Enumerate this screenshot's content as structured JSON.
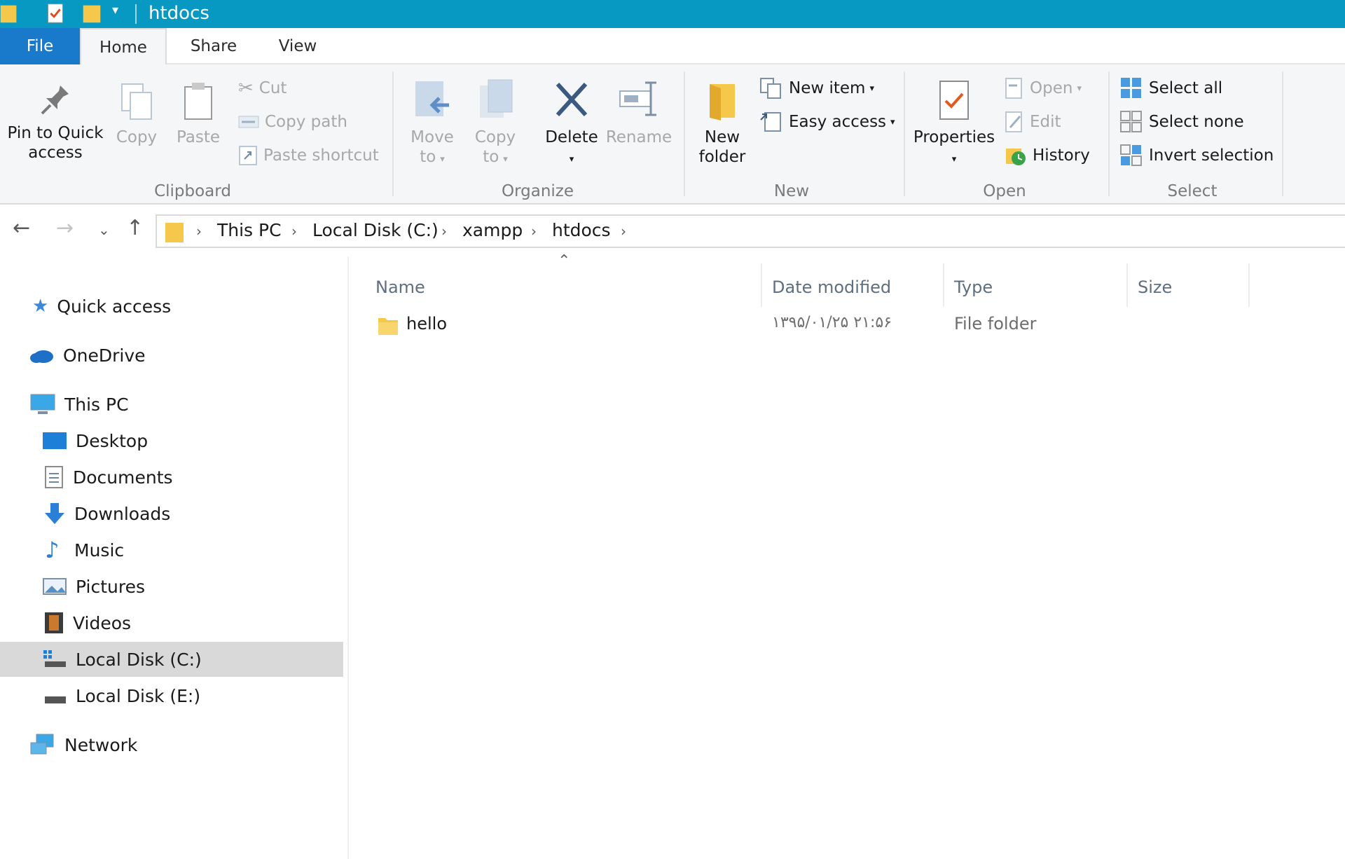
{
  "window": {
    "title": "htdocs"
  },
  "ribbon_tabs": {
    "file": "File",
    "home": "Home",
    "share": "Share",
    "view": "View"
  },
  "clipboard": {
    "group": "Clipboard",
    "pin": "Pin to Quick access",
    "pin_line1": "Pin to Quick",
    "pin_line2": "access",
    "copy": "Copy",
    "paste": "Paste",
    "cut": "Cut",
    "copy_path": "Copy path",
    "paste_shortcut": "Paste shortcut"
  },
  "organize": {
    "group": "Organize",
    "move_line1": "Move",
    "move_line2": "to",
    "copy_line1": "Copy",
    "copy_line2": "to",
    "delete": "Delete",
    "rename": "Rename"
  },
  "new": {
    "group": "New",
    "new_folder_line1": "New",
    "new_folder_line2": "folder",
    "new_item": "New item",
    "easy_access": "Easy access"
  },
  "open": {
    "group": "Open",
    "properties": "Properties",
    "open": "Open",
    "edit": "Edit",
    "history": "History"
  },
  "select": {
    "group": "Select",
    "select_all": "Select all",
    "select_none": "Select none",
    "invert": "Invert selection"
  },
  "breadcrumb": [
    "This PC",
    "Local Disk (C:)",
    "xampp",
    "htdocs"
  ],
  "nav_pane": {
    "quick_access": "Quick access",
    "onedrive": "OneDrive",
    "this_pc": "This PC",
    "desktop": "Desktop",
    "documents": "Documents",
    "downloads": "Downloads",
    "music": "Music",
    "pictures": "Pictures",
    "videos": "Videos",
    "local_c": "Local Disk (C:)",
    "local_e": "Local Disk (E:)",
    "network": "Network"
  },
  "columns": {
    "name": "Name",
    "date": "Date modified",
    "type": "Type",
    "size": "Size"
  },
  "files": [
    {
      "name": "hello",
      "date": "۱۳۹۵/۰۱/۲۵ ۲۱:۵۶",
      "type": "File folder",
      "size": ""
    }
  ],
  "colors": {
    "titlebar": "#0799c2",
    "file_tab": "#1979ca",
    "selected_nav": "#d9d9d9"
  }
}
